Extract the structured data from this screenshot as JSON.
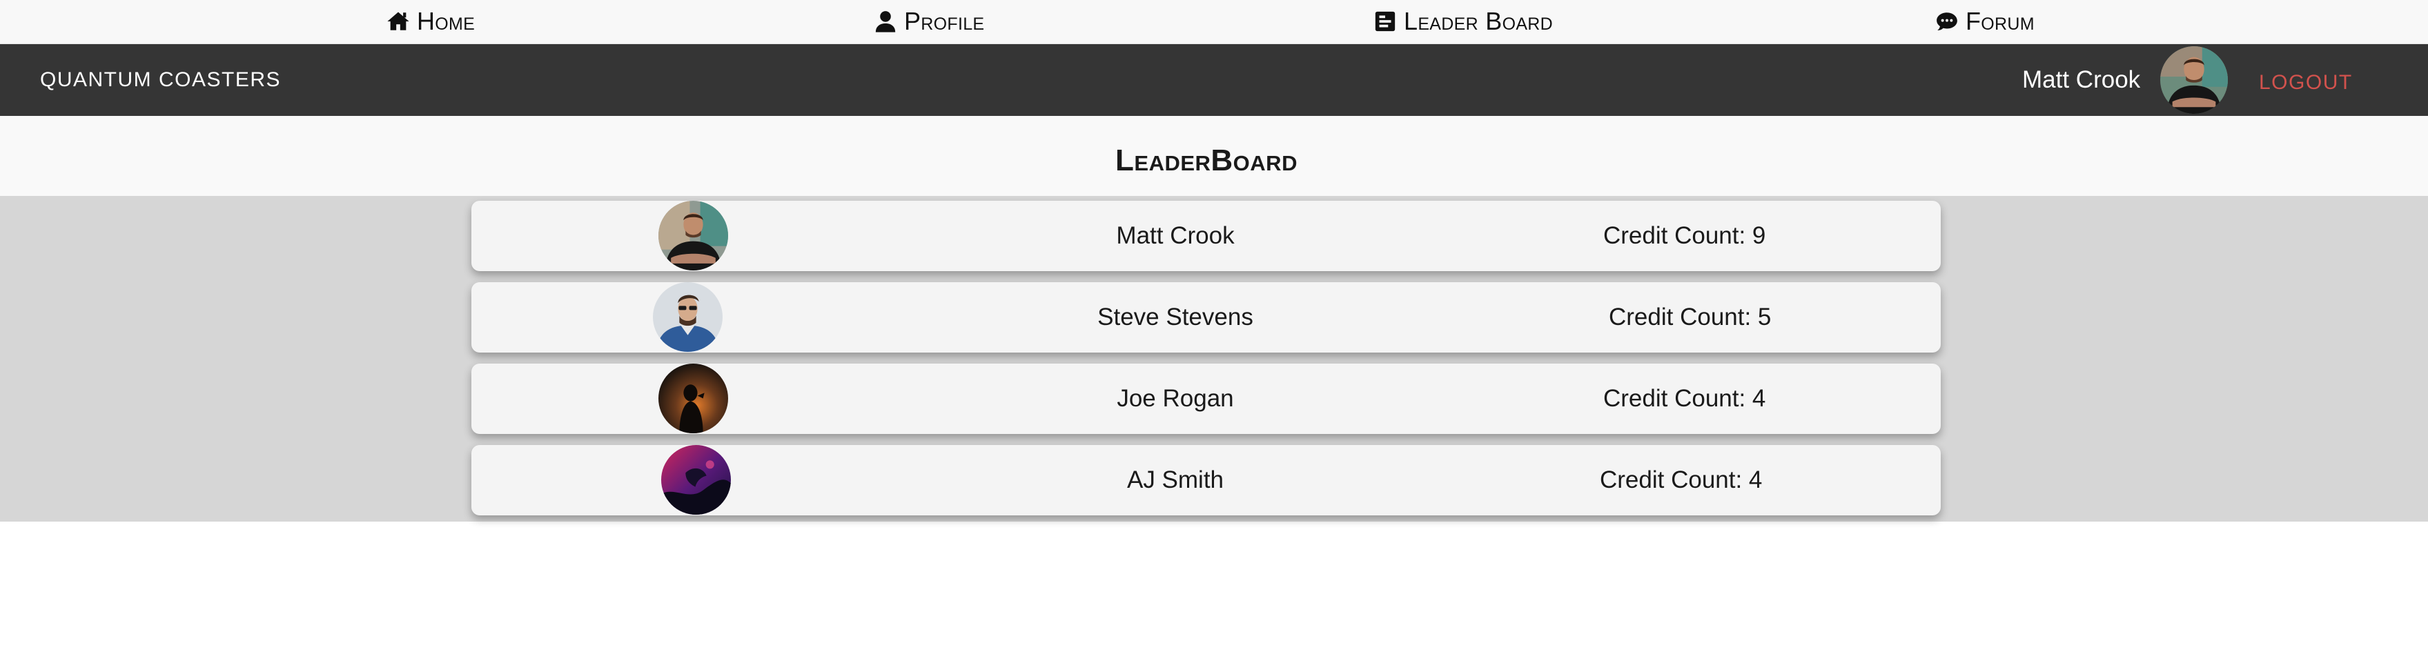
{
  "nav": {
    "items": [
      {
        "label": "Home",
        "icon": "home-icon"
      },
      {
        "label": "Profile",
        "icon": "user-icon"
      },
      {
        "label": "Leader Board",
        "icon": "leaderboard-icon"
      },
      {
        "label": "Forum",
        "icon": "comment-icon"
      }
    ]
  },
  "header": {
    "brand": "QUANTUM COASTERS",
    "user_name": "Matt Crook",
    "logout_label": "LOGOUT",
    "logout_color": "#d2524d",
    "background": "#353535"
  },
  "page": {
    "title": "LeaderBoard"
  },
  "leaderboard": {
    "entries": [
      {
        "name": "Matt Crook",
        "credit": "Credit Count: 9",
        "avatar": "avatar-man-black-shirt"
      },
      {
        "name": "Steve Stevens",
        "credit": "Credit Count: 5",
        "avatar": "avatar-man-sunglasses"
      },
      {
        "name": "Joe Rogan",
        "credit": "Credit Count: 4",
        "avatar": "avatar-silhouette-sunset"
      },
      {
        "name": "AJ Smith",
        "credit": "Credit Count: 4",
        "avatar": "avatar-purple-abstract"
      }
    ]
  }
}
